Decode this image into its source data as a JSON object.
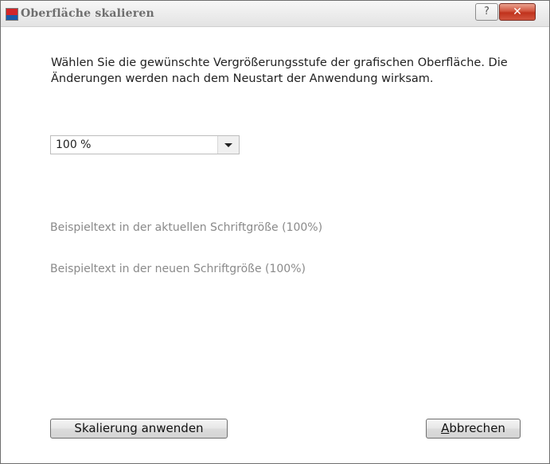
{
  "window": {
    "title": "Oberfläche skalieren",
    "help_glyph": "?",
    "close_glyph": "✕",
    "app_icon": "flag-icon"
  },
  "content": {
    "description": "Wählen Sie die gewünschte Vergrößerungsstufe der grafischen Oberfläche. Die Änderungen werden nach dem Neustart der Anwendung wirksam.",
    "scale_select": {
      "value": "100 %"
    },
    "sample_current": "Beispieltext in der aktuellen Schriftgröße (100%)",
    "sample_new": "Beispieltext in der neuen Schriftgröße (100%)"
  },
  "buttons": {
    "apply_label": "Skalierung anwenden",
    "cancel_label_mnemonic": "A",
    "cancel_label_rest": "bbrechen"
  },
  "colors": {
    "close_accent": "#c0321c",
    "title_text": "#6e6e6e",
    "sample_text": "#8a8a8a"
  }
}
